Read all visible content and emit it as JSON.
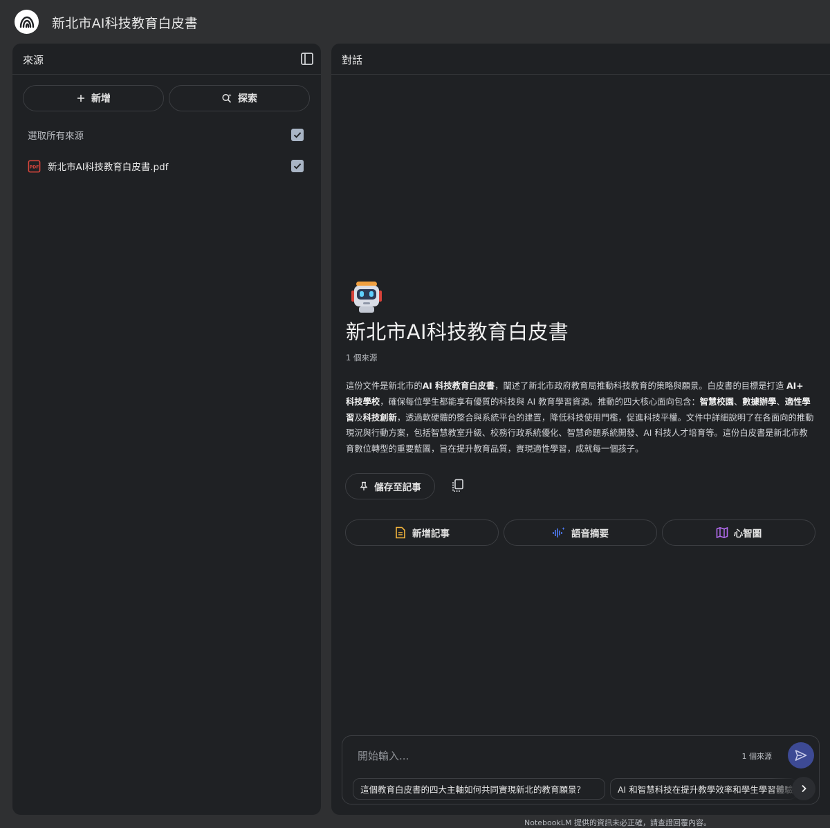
{
  "app": {
    "title": "新北市AI科技教育白皮書"
  },
  "sources_panel": {
    "title": "來源",
    "add_label": "新增",
    "explore_label": "探索",
    "select_all_label": "選取所有來源",
    "select_all_checked": true,
    "items": [
      {
        "name": "新北市AI科技教育白皮書.pdf",
        "type": "pdf-icon",
        "checked": true
      }
    ]
  },
  "chat_panel": {
    "title": "對話",
    "notebook_title": "新北市AI科技教育白皮書",
    "source_count": "1 個來源",
    "summary": {
      "p1": "這份文件是新北市的",
      "b1": "AI 科技教育白皮書",
      "p2": "，闡述了新北市政府教育局推動科技教育的策略與願景。白皮書的目標是打造 ",
      "b2": "AI+ 科技學校",
      "p3": "，確保每位學生都能享有優質的科技與 AI 教育學習資源。推動的四大核心面向包含：",
      "b3": "智慧校園",
      "p4": "、",
      "b4": "數據辦學",
      "p5": "、",
      "b5": "適性學習",
      "p6": "及",
      "b6": "科技創新",
      "p7": "，透過軟硬體的整合與系統平台的建置，降低科技使用門檻，促進科技平權。文件中詳細說明了在各面向的推動現況與行動方案，包括智慧教室升級、校務行政系統優化、智慧命題系統開發、AI 科技人才培育等。這份白皮書是新北市教育數位轉型的重要藍圖，旨在提升教育品質，實現適性學習，成就每一個孩子。"
    },
    "save_note_label": "儲存至記事",
    "actions": {
      "add_note": "新增記事",
      "audio_overview": "語音摘要",
      "mind_map": "心智圖"
    },
    "input": {
      "placeholder": "開始輸入...",
      "source_count": "1 個來源"
    },
    "suggestions": [
      "這個教育白皮書的四大主軸如何共同實現新北的教育願景？",
      "AI 和智慧科技在提升教學效率和學生學習體驗方面扮演什麼角色？"
    ],
    "disclaimer": "NotebookLM 提供的資訊未必正確，請查證回覆內容。"
  },
  "colors": {
    "background": "#2f3032",
    "panel": "#1f2124",
    "checkbox": "#a9b5c5",
    "send_button": "#3d4a94",
    "note_icon": "#f2b43c",
    "audio_icon": "#4f7cf7",
    "mindmap_icon": "#b46cf0",
    "pdf_icon": "#e0473d"
  }
}
